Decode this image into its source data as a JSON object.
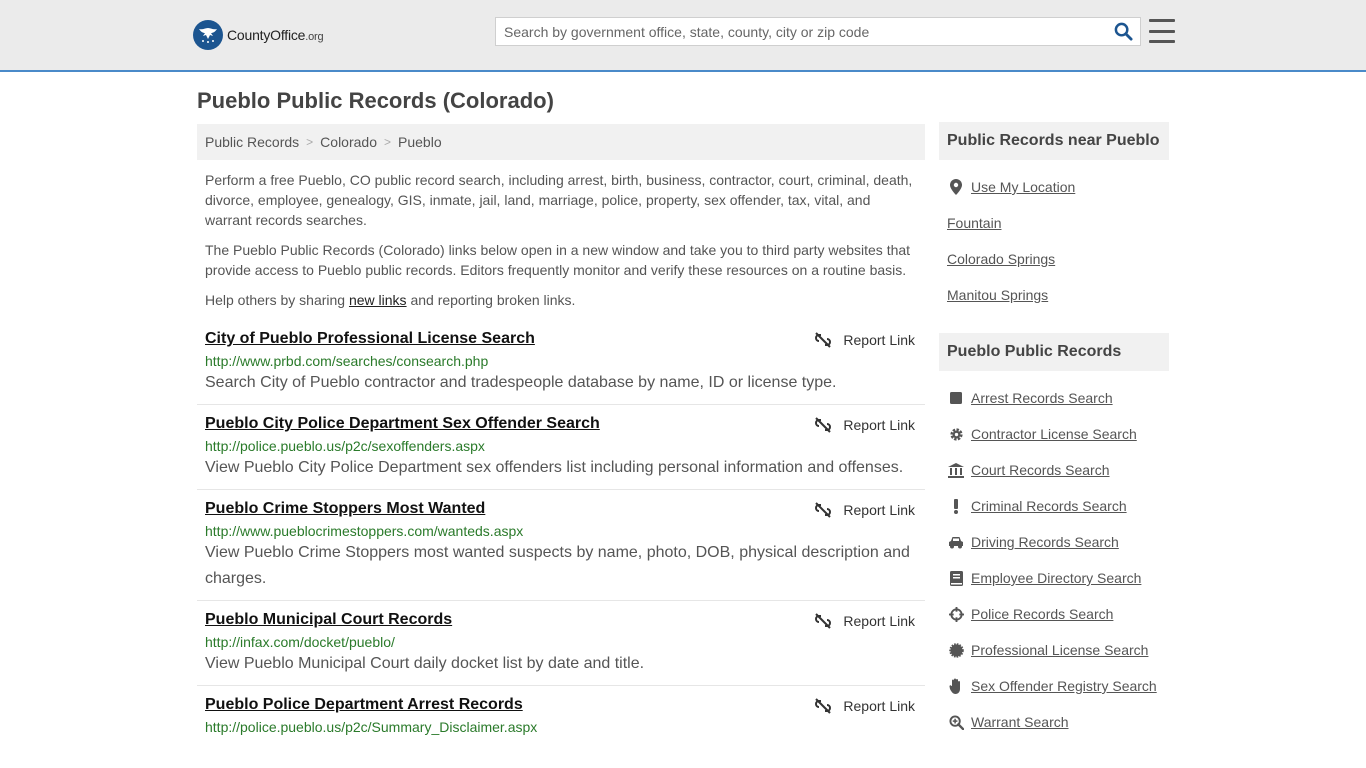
{
  "header": {
    "logo_text": "CountyOffice",
    "logo_suffix": ".org",
    "search_placeholder": "Search by government office, state, county, city or zip code"
  },
  "page_title": "Pueblo Public Records (Colorado)",
  "breadcrumb": [
    "Public Records",
    "Colorado",
    "Pueblo"
  ],
  "intro": {
    "p1": "Perform a free Pueblo, CO public record search, including arrest, birth, business, contractor, court, criminal, death, divorce, employee, genealogy, GIS, inmate, jail, land, marriage, police, property, sex offender, tax, vital, and warrant records searches.",
    "p2": "The Pueblo Public Records (Colorado) links below open in a new window and take you to third party websites that provide access to Pueblo public records. Editors frequently monitor and verify these resources on a routine basis.",
    "p3_before": "Help others by sharing ",
    "p3_link": "new links",
    "p3_after": " and reporting broken links."
  },
  "report_label": "Report Link",
  "results": [
    {
      "title": "City of Pueblo Professional License Search",
      "url": "http://www.prbd.com/searches/consearch.php",
      "desc": "Search City of Pueblo contractor and tradespeople database by name, ID or license type."
    },
    {
      "title": "Pueblo City Police Department Sex Offender Search",
      "url": "http://police.pueblo.us/p2c/sexoffenders.aspx",
      "desc": "View Pueblo City Police Department sex offenders list including personal information and offenses."
    },
    {
      "title": "Pueblo Crime Stoppers Most Wanted",
      "url": "http://www.pueblocrimestoppers.com/wanteds.aspx",
      "desc": "View Pueblo Crime Stoppers most wanted suspects by name, photo, DOB, physical description and charges."
    },
    {
      "title": "Pueblo Municipal Court Records",
      "url": "http://infax.com/docket/pueblo/",
      "desc": "View Pueblo Municipal Court daily docket list by date and title."
    },
    {
      "title": "Pueblo Police Department Arrest Records",
      "url": "http://police.pueblo.us/p2c/Summary_Disclaimer.aspx",
      "desc": ""
    }
  ],
  "sidebar": {
    "near_title": "Public Records near Pueblo",
    "near_items": [
      {
        "label": "Use My Location",
        "icon": "location-pin-icon"
      },
      {
        "label": "Fountain"
      },
      {
        "label": "Colorado Springs"
      },
      {
        "label": "Manitou Springs"
      }
    ],
    "records_title": "Pueblo Public Records",
    "records_items": [
      {
        "label": "Arrest Records Search",
        "icon": "square-icon"
      },
      {
        "label": "Contractor License Search",
        "icon": "gear-icon"
      },
      {
        "label": "Court Records Search",
        "icon": "courthouse-icon"
      },
      {
        "label": "Criminal Records Search",
        "icon": "exclamation-icon"
      },
      {
        "label": "Driving Records Search",
        "icon": "car-icon"
      },
      {
        "label": "Employee Directory Search",
        "icon": "book-icon"
      },
      {
        "label": "Police Records Search",
        "icon": "crosshair-icon"
      },
      {
        "label": "Professional License Search",
        "icon": "badge-icon"
      },
      {
        "label": "Sex Offender Registry Search",
        "icon": "hand-icon"
      },
      {
        "label": "Warrant Search",
        "icon": "magnifier-plus-icon"
      }
    ]
  }
}
